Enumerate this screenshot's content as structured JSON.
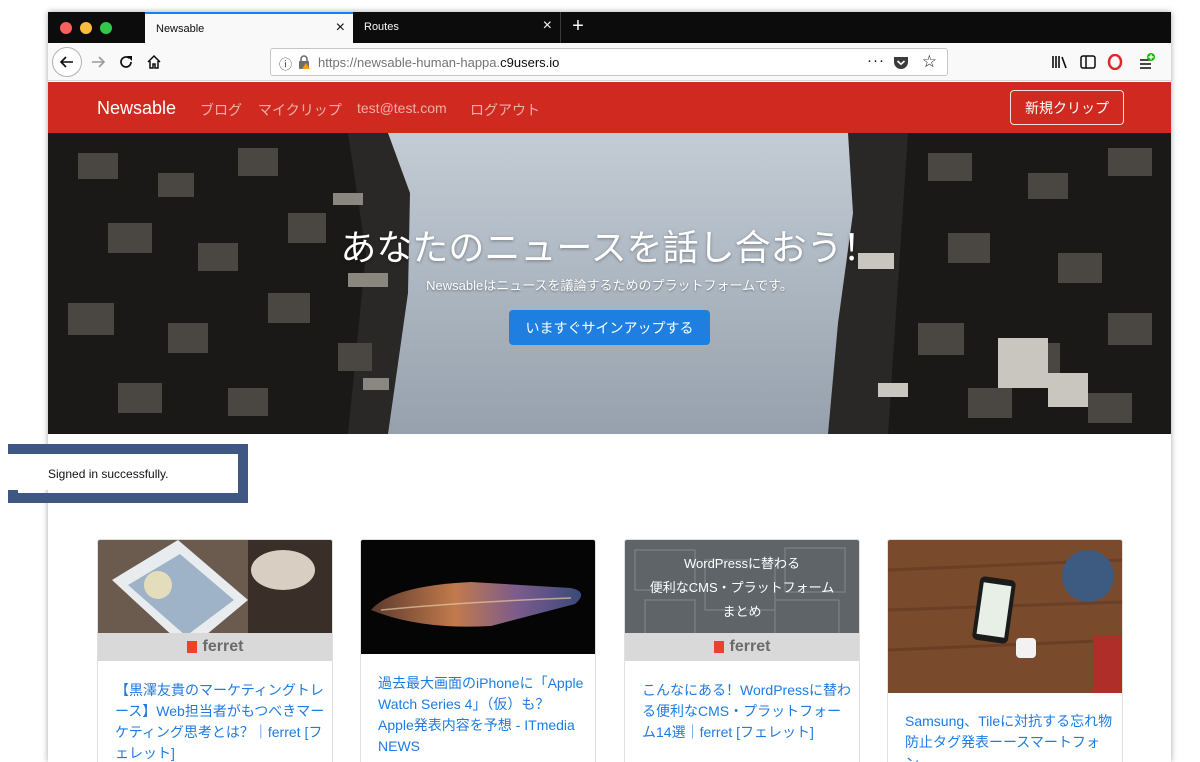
{
  "browser": {
    "tabs": [
      {
        "label": "Newsable",
        "active": true
      },
      {
        "label": "Routes",
        "active": false
      }
    ],
    "close_glyph": "×",
    "new_tab_glyph": "+",
    "url": {
      "prefix": "https://newsable-human-happa.",
      "host": "c9users.io"
    },
    "page_actions_glyph": "···",
    "star_glyph": "☆",
    "icons": [
      "back-icon",
      "forward-icon",
      "reload-icon",
      "home-icon",
      "info-icon",
      "lock-icon",
      "pocket-icon",
      "bookmark-star-icon",
      "library-icon",
      "sidebar-icon",
      "opera-icon",
      "menu-icon"
    ]
  },
  "navbar": {
    "brand": "Newsable",
    "links": [
      "ブログ",
      "マイクリップ",
      "test@test.com",
      "ログアウト"
    ],
    "new_clip": "新規クリップ",
    "bg_color": "#d02a20"
  },
  "hero": {
    "title": "あなたのニュースを話し合おう！",
    "subtitle": "Newsableはニュースを議論するためのプラットフォームです。",
    "cta": "いますぐサインアップする",
    "cta_color": "#1f7fe0"
  },
  "flash": {
    "message": "Signed in successfully."
  },
  "cards": [
    {
      "title": "【黒澤友貴のマーケティングトレース】Web担当者がもつべきマーケティング思考とは？｜ferret [フェレット]",
      "badge": "ferret"
    },
    {
      "title": "過去最大画面のiPhoneに「Apple Watch Series 4」（仮）も？　Apple発表内容を予想 - ITmedia NEWS"
    },
    {
      "title": "こんなにある！WordPressに替わる便利なCMS・プラットフォーム14選｜ferret [フェレット]",
      "badge": "ferret",
      "overlay": [
        "WordPressに替わる",
        "便利なCMS・プラットフォーム",
        "まとめ"
      ]
    },
    {
      "title": "Samsung、Tileに対抗する忘れ物防止タグ発表ーースマートフォン..."
    }
  ]
}
